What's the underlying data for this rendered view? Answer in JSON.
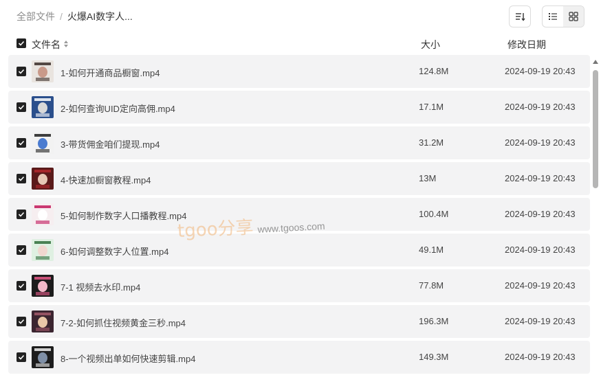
{
  "breadcrumb": {
    "root": "全部文件",
    "separator": "/",
    "current": "火爆AI数字人..."
  },
  "toolbar": {
    "sort_icon": "sort-icon",
    "list_view_icon": "list-view-icon",
    "grid_view_icon": "grid-view-icon",
    "active_view": "list"
  },
  "columns": {
    "name": "文件名",
    "size": "大小",
    "date": "修改日期"
  },
  "files": [
    {
      "name": "1-如何开通商品橱窗.mp4",
      "size": "124.8M",
      "date": "2024-09-19 20:43",
      "checked": true,
      "thumb": "video-thumbnail"
    },
    {
      "name": "2-如何查询UID定向高佣.mp4",
      "size": "17.1M",
      "date": "2024-09-19 20:43",
      "checked": true,
      "thumb": "video-thumbnail"
    },
    {
      "name": "3-带货佣金咱们提现.mp4",
      "size": "31.2M",
      "date": "2024-09-19 20:43",
      "checked": true,
      "thumb": "video-thumbnail"
    },
    {
      "name": "4-快速加橱窗教程.mp4",
      "size": "13M",
      "date": "2024-09-19 20:43",
      "checked": true,
      "thumb": "video-thumbnail"
    },
    {
      "name": "5-如何制作数字人口播教程.mp4",
      "size": "100.4M",
      "date": "2024-09-19 20:43",
      "checked": true,
      "thumb": "video-thumbnail"
    },
    {
      "name": "6-如何调整数字人位置.mp4",
      "size": "49.1M",
      "date": "2024-09-19 20:43",
      "checked": true,
      "thumb": "video-thumbnail"
    },
    {
      "name": "7-1 视频去水印.mp4",
      "size": "77.8M",
      "date": "2024-09-19 20:43",
      "checked": true,
      "thumb": "video-thumbnail"
    },
    {
      "name": "7-2-如何抓住视频黄金三秒.mp4",
      "size": "196.3M",
      "date": "2024-09-19 20:43",
      "checked": true,
      "thumb": "video-thumbnail"
    },
    {
      "name": "8-一个视频出单如何快速剪辑.mp4",
      "size": "149.3M",
      "date": "2024-09-19 20:43",
      "checked": true,
      "thumb": "video-thumbnail"
    }
  ],
  "watermark": {
    "brand": "tgoo分享",
    "url": "www.tgoos.com"
  },
  "colors": {
    "row_bg": "#f3f3f4",
    "checkbox": "#222222",
    "text": "#444444",
    "muted": "#8c8c8c"
  }
}
